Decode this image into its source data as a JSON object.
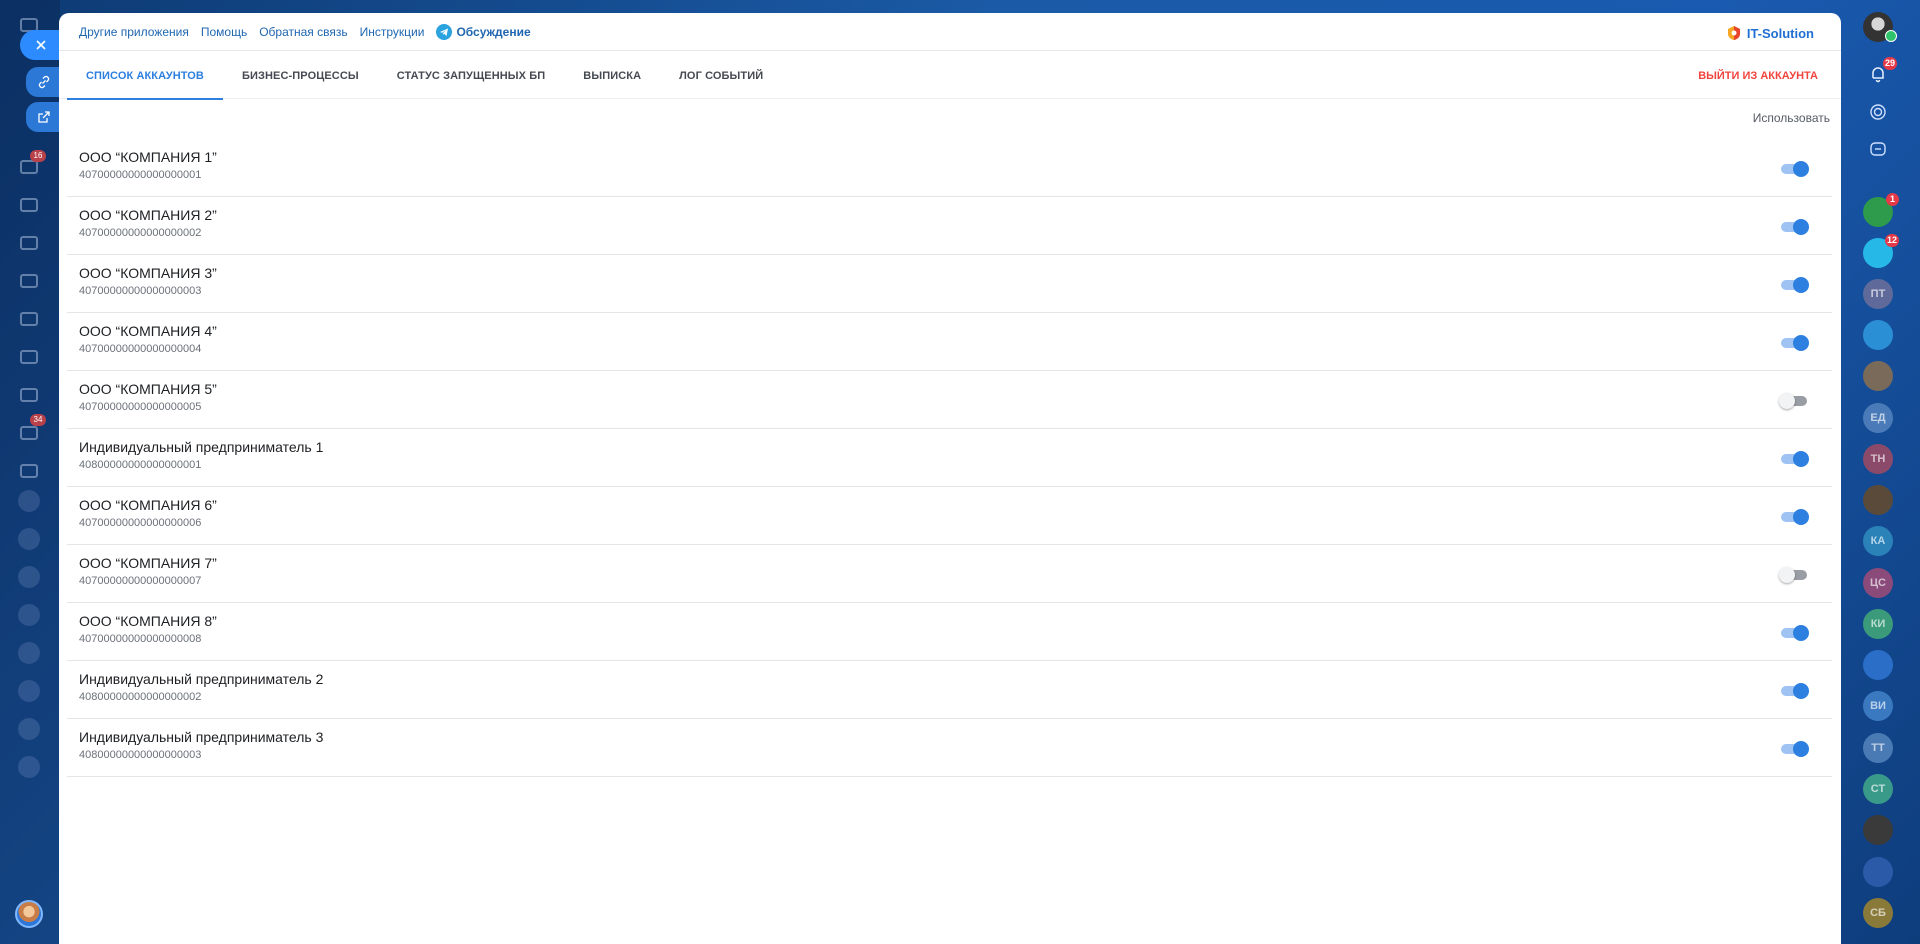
{
  "topbar": {
    "links": [
      "Другие приложения",
      "Помощь",
      "Обратная связь",
      "Инструкции"
    ],
    "discuss_label": "Обсуждение",
    "brand": "IT-Solution"
  },
  "tabs": [
    {
      "label": "Список аккаунтов",
      "active": true
    },
    {
      "label": "Бизнес-процессы",
      "active": false
    },
    {
      "label": "Статус запущенных БП",
      "active": false
    },
    {
      "label": "Выписка",
      "active": false
    },
    {
      "label": "Лог событий",
      "active": false
    }
  ],
  "logout_label": "Выйти из аккаунта",
  "use_column_label": "Использовать",
  "accounts": [
    {
      "name": "ООО “КОМПАНИЯ 1”",
      "number": "40700000000000000001",
      "enabled": true
    },
    {
      "name": "ООО “КОМПАНИЯ 2”",
      "number": "40700000000000000002",
      "enabled": true
    },
    {
      "name": "ООО “КОМПАНИЯ 3”",
      "number": "40700000000000000003",
      "enabled": true
    },
    {
      "name": "ООО “КОМПАНИЯ 4”",
      "number": "40700000000000000004",
      "enabled": true
    },
    {
      "name": "ООО “КОМПАНИЯ 5”",
      "number": "40700000000000000005",
      "enabled": false
    },
    {
      "name": "Индивидуальный предприниматель 1",
      "number": "40800000000000000001",
      "enabled": true
    },
    {
      "name": "ООО “КОМПАНИЯ 6”",
      "number": "40700000000000000006",
      "enabled": true
    },
    {
      "name": "ООО “КОМПАНИЯ 7”",
      "number": "40700000000000000007",
      "enabled": false
    },
    {
      "name": "ООО “КОМПАНИЯ 8”",
      "number": "40700000000000000008",
      "enabled": true
    },
    {
      "name": "Индивидуальный предприниматель 2",
      "number": "40800000000000000002",
      "enabled": true
    },
    {
      "name": "Индивидуальный предприниматель 3",
      "number": "40800000000000000003",
      "enabled": true
    }
  ],
  "left_sidebar": {
    "badges": [
      "16",
      "34"
    ]
  },
  "right_sidebar": {
    "notification_count": "29",
    "chat_badges": [
      "1",
      "12"
    ],
    "avatars": [
      "ПТ",
      "ЕД",
      "ТН",
      "КА",
      "ЦС",
      "КИ",
      "ВИ",
      "ТТ",
      "СТ",
      "СБ"
    ]
  },
  "colors": {
    "accent": "#2d7fe0",
    "logout": "#f0453e",
    "link": "#2067b0"
  }
}
